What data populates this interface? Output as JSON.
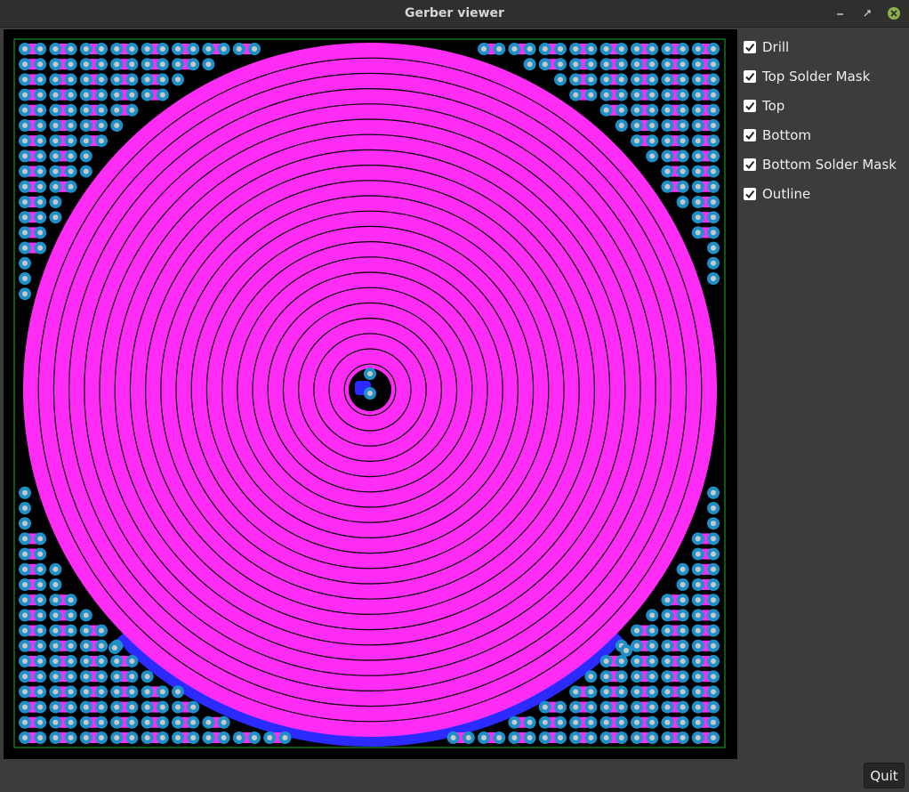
{
  "window": {
    "title": "Gerber viewer"
  },
  "layers": [
    {
      "label": "Drill",
      "checked": true
    },
    {
      "label": "Top Solder Mask",
      "checked": true
    },
    {
      "label": "Top",
      "checked": true
    },
    {
      "label": "Bottom",
      "checked": true
    },
    {
      "label": "Bottom Solder Mask",
      "checked": true
    },
    {
      "label": "Outline",
      "checked": true
    }
  ],
  "buttons": {
    "quit": "Quit"
  },
  "colors": {
    "background": "#000000",
    "top_copper": "#ff2cf5",
    "bottom_copper": "#2b2bff",
    "solder_mask_pad": "#1e90c8",
    "drill": "#c8c8c8",
    "outline": "#1a8f1a"
  }
}
